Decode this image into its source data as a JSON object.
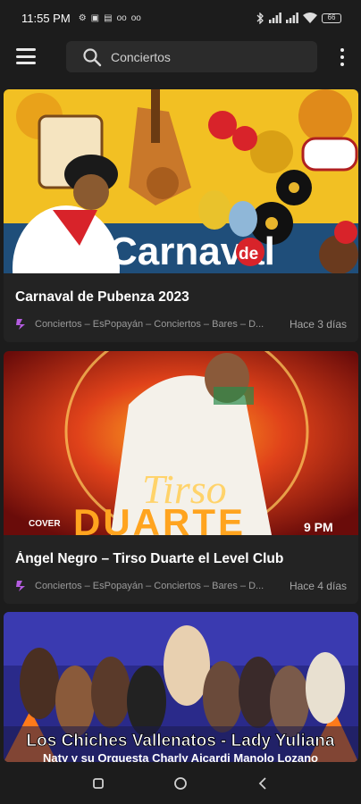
{
  "status_bar": {
    "time": "11:55 PM",
    "icons": [
      "gear-icon",
      "image-icon",
      "sim-icon",
      "voicemail-icon",
      "voicemail-icon",
      "bluetooth-icon",
      "signal-icon",
      "signal-icon",
      "wifi-icon",
      "battery-icon"
    ],
    "battery": "66"
  },
  "top_bar": {
    "search_text": "Conciertos",
    "icons": [
      "hamburger-menu-icon",
      "search-icon",
      "more-vertical-icon"
    ]
  },
  "posts": [
    {
      "image_text_1": "Carnaval",
      "image_text_2": "de",
      "title": "Carnaval de Pubenza 2023",
      "categories": "Conciertos – EsPopayán – Conciertos – Bares – D...",
      "time": "Hace 3 días"
    },
    {
      "image_text_1": "Tirso",
      "image_text_2": "DUARTE",
      "image_text_3": "COVER",
      "image_text_4": "9 PM",
      "title": "Ángel Negro – Tirso Duarte el Level Club",
      "categories": "Conciertos – EsPopayán – Conciertos – Bares – D...",
      "time": "Hace 4 días"
    },
    {
      "image_text_1": "Los Chiches Vallenatos - Lady Yuliana",
      "image_text_2": "Naty y su Orquesta   Charly Aicardi   Manolo Lozano"
    }
  ],
  "colors": {
    "background": "#1c1c1c",
    "card": "#232323",
    "search": "#2b2b2b",
    "accent_purple": "#b45ce0"
  },
  "nav_bar": {
    "icons": [
      "recents-square-icon",
      "home-circle-icon",
      "back-chevron-icon"
    ]
  }
}
